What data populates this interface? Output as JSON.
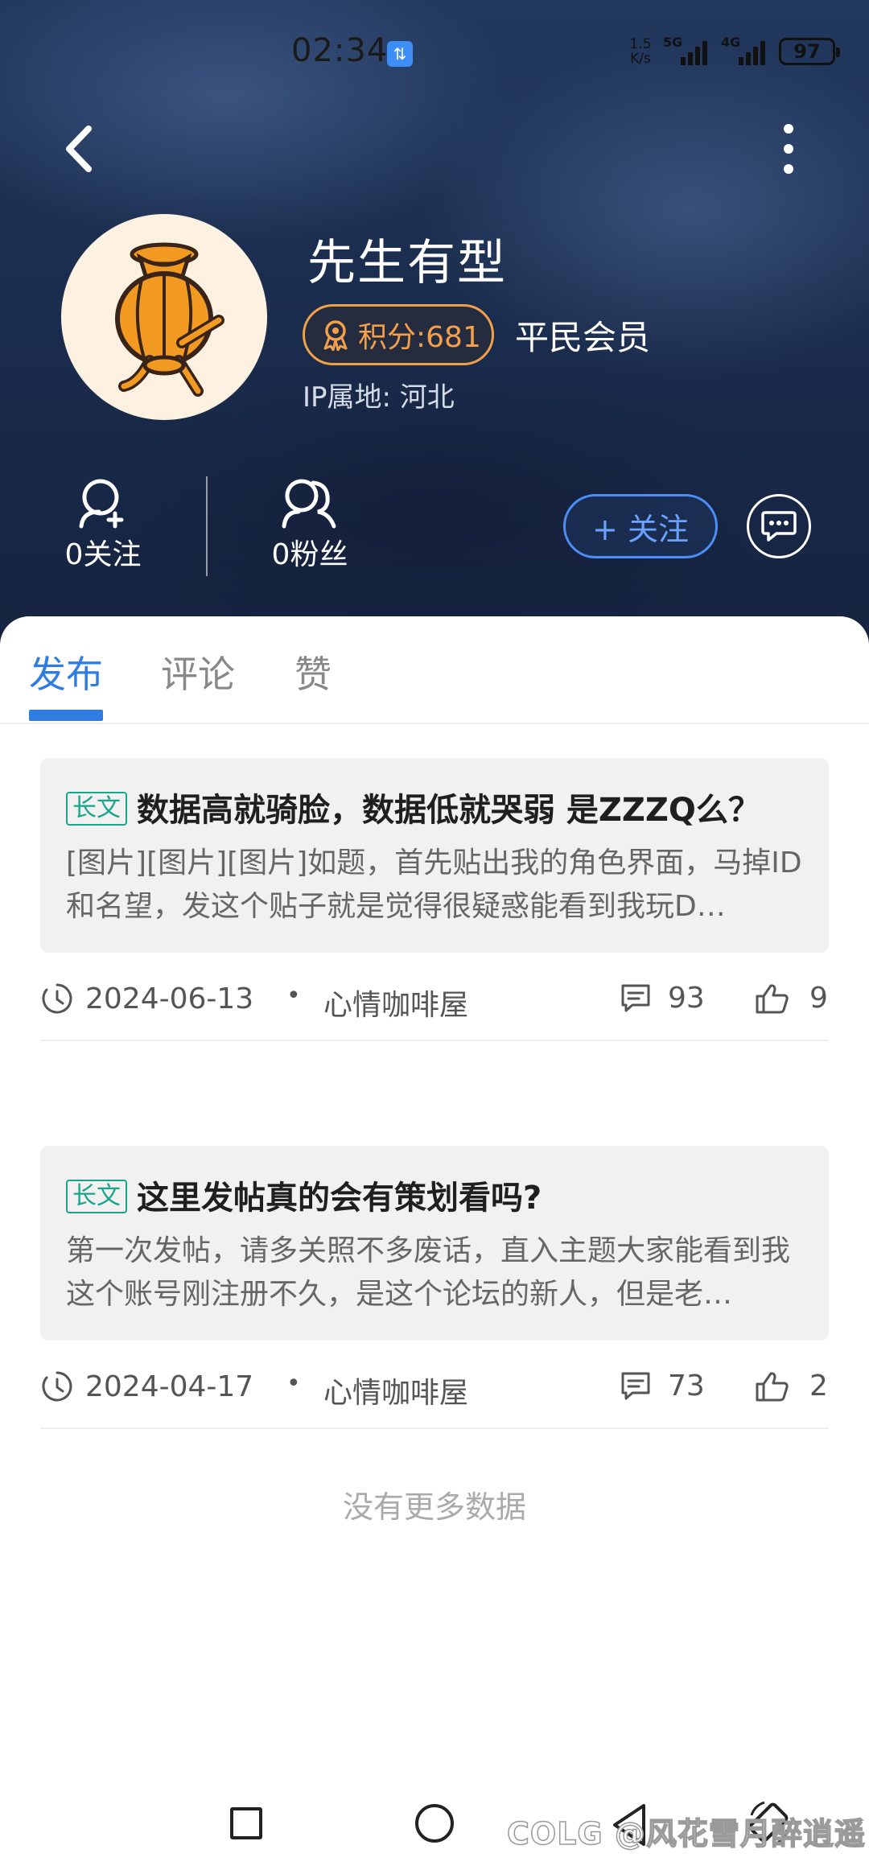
{
  "status_bar": {
    "time": "02:34",
    "notification_glyph": "⇅",
    "net_speed_top": "1.5",
    "net_speed_bottom": "K/s",
    "signal_1": "5G",
    "signal_2": "4G",
    "battery": "97"
  },
  "profile": {
    "username": "先生有型",
    "points": "积分:681",
    "member_level": "平民会员",
    "ip_location": "IP属地: 河北",
    "following": "0关注",
    "fans": "0粉丝",
    "follow_button": "+ 关注"
  },
  "tabs": [
    "发布",
    "评论",
    "赞"
  ],
  "posts": [
    {
      "tag": "长文",
      "title": "数据高就骑脸，数据低就哭弱 是ZZZQ么？",
      "excerpt": "[图片][图片][图片]如题，首先贴出我的角色界面，马掉ID和名望，发这个贴子就是觉得很疑惑能看到我玩D…",
      "date": "2024-06-13",
      "board": "心情咖啡屋",
      "comments": "93",
      "likes": "9"
    },
    {
      "tag": "长文",
      "title": "这里发帖真的会有策划看吗?",
      "excerpt": "第一次发帖，请多关照不多废话，直入主题大家能看到我这个账号刚注册不久，是这个论坛的新人，但是老…",
      "date": "2024-04-17",
      "board": "心情咖啡屋",
      "comments": "73",
      "likes": "2"
    }
  ],
  "meta_separator": "•",
  "footer_text": "没有更多数据",
  "watermark": "COLG @风花雪月醉逍遥",
  "colors": {
    "accent": "#2f7de1",
    "points": "#f4a04a",
    "tag": "#1aa58a",
    "hero": "#1b2d4e"
  }
}
